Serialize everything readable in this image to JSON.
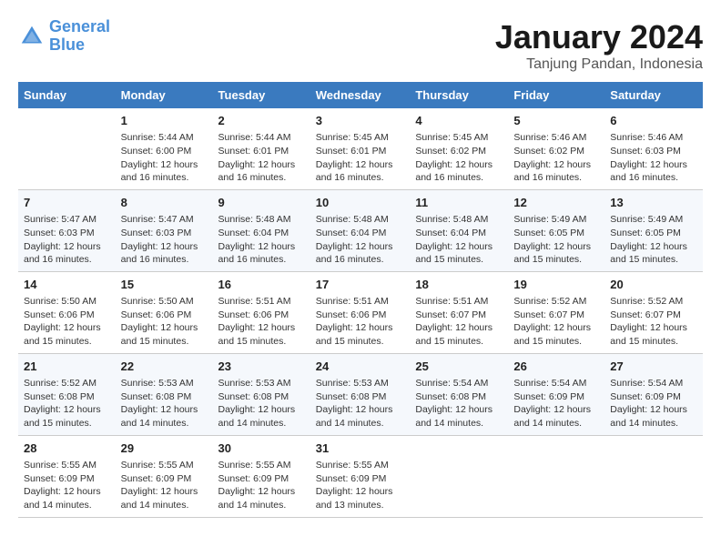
{
  "header": {
    "logo_line1": "General",
    "logo_line2": "Blue",
    "month": "January 2024",
    "location": "Tanjung Pandan, Indonesia"
  },
  "weekdays": [
    "Sunday",
    "Monday",
    "Tuesday",
    "Wednesday",
    "Thursday",
    "Friday",
    "Saturday"
  ],
  "weeks": [
    [
      {
        "day": "",
        "info": ""
      },
      {
        "day": "1",
        "info": "Sunrise: 5:44 AM\nSunset: 6:00 PM\nDaylight: 12 hours and 16 minutes."
      },
      {
        "day": "2",
        "info": "Sunrise: 5:44 AM\nSunset: 6:01 PM\nDaylight: 12 hours and 16 minutes."
      },
      {
        "day": "3",
        "info": "Sunrise: 5:45 AM\nSunset: 6:01 PM\nDaylight: 12 hours and 16 minutes."
      },
      {
        "day": "4",
        "info": "Sunrise: 5:45 AM\nSunset: 6:02 PM\nDaylight: 12 hours and 16 minutes."
      },
      {
        "day": "5",
        "info": "Sunrise: 5:46 AM\nSunset: 6:02 PM\nDaylight: 12 hours and 16 minutes."
      },
      {
        "day": "6",
        "info": "Sunrise: 5:46 AM\nSunset: 6:03 PM\nDaylight: 12 hours and 16 minutes."
      }
    ],
    [
      {
        "day": "7",
        "info": "Sunrise: 5:47 AM\nSunset: 6:03 PM\nDaylight: 12 hours and 16 minutes."
      },
      {
        "day": "8",
        "info": "Sunrise: 5:47 AM\nSunset: 6:03 PM\nDaylight: 12 hours and 16 minutes."
      },
      {
        "day": "9",
        "info": "Sunrise: 5:48 AM\nSunset: 6:04 PM\nDaylight: 12 hours and 16 minutes."
      },
      {
        "day": "10",
        "info": "Sunrise: 5:48 AM\nSunset: 6:04 PM\nDaylight: 12 hours and 16 minutes."
      },
      {
        "day": "11",
        "info": "Sunrise: 5:48 AM\nSunset: 6:04 PM\nDaylight: 12 hours and 15 minutes."
      },
      {
        "day": "12",
        "info": "Sunrise: 5:49 AM\nSunset: 6:05 PM\nDaylight: 12 hours and 15 minutes."
      },
      {
        "day": "13",
        "info": "Sunrise: 5:49 AM\nSunset: 6:05 PM\nDaylight: 12 hours and 15 minutes."
      }
    ],
    [
      {
        "day": "14",
        "info": "Sunrise: 5:50 AM\nSunset: 6:06 PM\nDaylight: 12 hours and 15 minutes."
      },
      {
        "day": "15",
        "info": "Sunrise: 5:50 AM\nSunset: 6:06 PM\nDaylight: 12 hours and 15 minutes."
      },
      {
        "day": "16",
        "info": "Sunrise: 5:51 AM\nSunset: 6:06 PM\nDaylight: 12 hours and 15 minutes."
      },
      {
        "day": "17",
        "info": "Sunrise: 5:51 AM\nSunset: 6:06 PM\nDaylight: 12 hours and 15 minutes."
      },
      {
        "day": "18",
        "info": "Sunrise: 5:51 AM\nSunset: 6:07 PM\nDaylight: 12 hours and 15 minutes."
      },
      {
        "day": "19",
        "info": "Sunrise: 5:52 AM\nSunset: 6:07 PM\nDaylight: 12 hours and 15 minutes."
      },
      {
        "day": "20",
        "info": "Sunrise: 5:52 AM\nSunset: 6:07 PM\nDaylight: 12 hours and 15 minutes."
      }
    ],
    [
      {
        "day": "21",
        "info": "Sunrise: 5:52 AM\nSunset: 6:08 PM\nDaylight: 12 hours and 15 minutes."
      },
      {
        "day": "22",
        "info": "Sunrise: 5:53 AM\nSunset: 6:08 PM\nDaylight: 12 hours and 14 minutes."
      },
      {
        "day": "23",
        "info": "Sunrise: 5:53 AM\nSunset: 6:08 PM\nDaylight: 12 hours and 14 minutes."
      },
      {
        "day": "24",
        "info": "Sunrise: 5:53 AM\nSunset: 6:08 PM\nDaylight: 12 hours and 14 minutes."
      },
      {
        "day": "25",
        "info": "Sunrise: 5:54 AM\nSunset: 6:08 PM\nDaylight: 12 hours and 14 minutes."
      },
      {
        "day": "26",
        "info": "Sunrise: 5:54 AM\nSunset: 6:09 PM\nDaylight: 12 hours and 14 minutes."
      },
      {
        "day": "27",
        "info": "Sunrise: 5:54 AM\nSunset: 6:09 PM\nDaylight: 12 hours and 14 minutes."
      }
    ],
    [
      {
        "day": "28",
        "info": "Sunrise: 5:55 AM\nSunset: 6:09 PM\nDaylight: 12 hours and 14 minutes."
      },
      {
        "day": "29",
        "info": "Sunrise: 5:55 AM\nSunset: 6:09 PM\nDaylight: 12 hours and 14 minutes."
      },
      {
        "day": "30",
        "info": "Sunrise: 5:55 AM\nSunset: 6:09 PM\nDaylight: 12 hours and 14 minutes."
      },
      {
        "day": "31",
        "info": "Sunrise: 5:55 AM\nSunset: 6:09 PM\nDaylight: 12 hours and 13 minutes."
      },
      {
        "day": "",
        "info": ""
      },
      {
        "day": "",
        "info": ""
      },
      {
        "day": "",
        "info": ""
      }
    ]
  ]
}
